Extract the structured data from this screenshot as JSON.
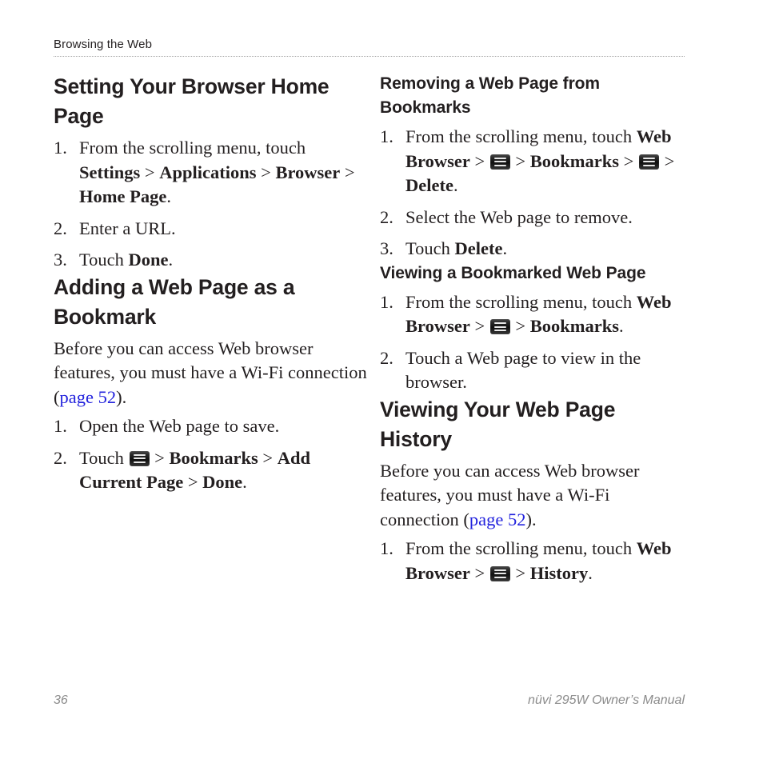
{
  "header": {
    "chapter": "Browsing the Web"
  },
  "footer": {
    "page_number": "36",
    "manual_title": "nüvi 295W Owner’s Manual"
  },
  "icons": {
    "menu_icon_name": "menu-icon"
  },
  "colors": {
    "link": "#2222dd",
    "text": "#231f20",
    "footer_text": "#8b8b8b",
    "rule": "#a8a8a8"
  },
  "left_column": {
    "section1": {
      "heading": "Setting Your Browser Home Page",
      "steps": [
        {
          "number": "1.",
          "parts": [
            {
              "type": "text",
              "value": "From the scrolling menu, touch "
            },
            {
              "type": "bold",
              "value": "Settings"
            },
            {
              "type": "sep",
              "value": " > "
            },
            {
              "type": "bold",
              "value": "Applications"
            },
            {
              "type": "sep",
              "value": " > "
            },
            {
              "type": "bold",
              "value": "Browser"
            },
            {
              "type": "sep",
              "value": " > "
            },
            {
              "type": "bold",
              "value": "Home Page"
            },
            {
              "type": "text",
              "value": "."
            }
          ]
        },
        {
          "number": "2.",
          "parts": [
            {
              "type": "text",
              "value": "Enter a URL."
            }
          ]
        },
        {
          "number": "3.",
          "parts": [
            {
              "type": "text",
              "value": "Touch "
            },
            {
              "type": "bold",
              "value": "Done"
            },
            {
              "type": "text",
              "value": "."
            }
          ]
        }
      ]
    },
    "section2": {
      "heading": "Adding a Web Page as a Bookmark",
      "intro": {
        "before_link": "Before you can access Web browser features, you must have a Wi-Fi connection (",
        "link": "page 52",
        "after_link": ")."
      },
      "steps": [
        {
          "number": "1.",
          "parts": [
            {
              "type": "text",
              "value": "Open the Web page to save."
            }
          ]
        },
        {
          "number": "2.",
          "parts": [
            {
              "type": "text",
              "value": "Touch "
            },
            {
              "type": "icon",
              "value": "menu-icon"
            },
            {
              "type": "sep",
              "value": " > "
            },
            {
              "type": "bold",
              "value": "Bookmarks"
            },
            {
              "type": "sep",
              "value": " > "
            },
            {
              "type": "bold",
              "value": "Add Current Page"
            },
            {
              "type": "sep",
              "value": " > "
            },
            {
              "type": "bold",
              "value": "Done"
            },
            {
              "type": "text",
              "value": "."
            }
          ]
        }
      ]
    }
  },
  "right_column": {
    "section1": {
      "heading": "Removing a Web Page from Bookmarks",
      "steps": [
        {
          "number": "1.",
          "parts": [
            {
              "type": "text",
              "value": "From the scrolling menu, touch "
            },
            {
              "type": "bold",
              "value": "Web Browser"
            },
            {
              "type": "sep",
              "value": " > "
            },
            {
              "type": "icon",
              "value": "menu-icon"
            },
            {
              "type": "sep",
              "value": " > "
            },
            {
              "type": "bold",
              "value": "Bookmarks"
            },
            {
              "type": "sep",
              "value": " > "
            },
            {
              "type": "icon",
              "value": "menu-icon"
            },
            {
              "type": "sep",
              "value": " > "
            },
            {
              "type": "bold",
              "value": "Delete"
            },
            {
              "type": "text",
              "value": "."
            }
          ]
        },
        {
          "number": "2.",
          "parts": [
            {
              "type": "text",
              "value": "Select the Web page to remove."
            }
          ]
        },
        {
          "number": "3.",
          "parts": [
            {
              "type": "text",
              "value": "Touch "
            },
            {
              "type": "bold",
              "value": "Delete"
            },
            {
              "type": "text",
              "value": "."
            }
          ]
        }
      ]
    },
    "section2": {
      "heading": "Viewing a Bookmarked Web Page",
      "steps": [
        {
          "number": "1.",
          "parts": [
            {
              "type": "text",
              "value": "From the scrolling menu, touch "
            },
            {
              "type": "bold",
              "value": "Web Browser"
            },
            {
              "type": "sep",
              "value": " > "
            },
            {
              "type": "icon",
              "value": "menu-icon"
            },
            {
              "type": "sep",
              "value": " > "
            },
            {
              "type": "bold",
              "value": "Bookmarks"
            },
            {
              "type": "text",
              "value": "."
            }
          ]
        },
        {
          "number": "2.",
          "parts": [
            {
              "type": "text",
              "value": "Touch a Web page to view in the browser."
            }
          ]
        }
      ]
    },
    "section3": {
      "heading": "Viewing Your Web Page History",
      "intro": {
        "before_link": "Before you can access Web browser features, you must have a Wi-Fi connection (",
        "link": "page 52",
        "after_link": ")."
      },
      "steps": [
        {
          "number": "1.",
          "parts": [
            {
              "type": "text",
              "value": "From the scrolling menu, touch "
            },
            {
              "type": "bold",
              "value": "Web Browser"
            },
            {
              "type": "sep",
              "value": " > "
            },
            {
              "type": "icon",
              "value": "menu-icon"
            },
            {
              "type": "sep",
              "value": " > "
            },
            {
              "type": "bold",
              "value": "History"
            },
            {
              "type": "text",
              "value": "."
            }
          ]
        }
      ]
    }
  }
}
